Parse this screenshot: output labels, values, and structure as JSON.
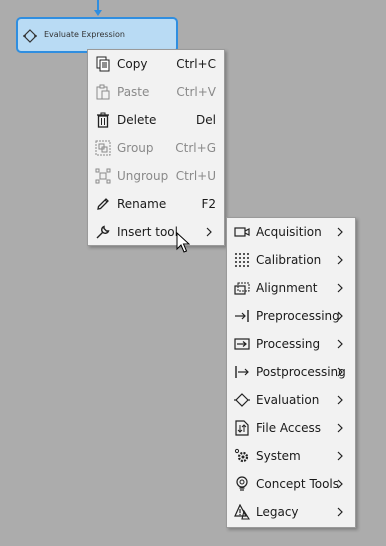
{
  "canvas": {
    "background": "#acacac",
    "accent": "#2f8ee0"
  },
  "node": {
    "label": "Evaluate Expression",
    "icon": "evaluation-icon",
    "fill": "#b9dbf4"
  },
  "context_menu": {
    "items": [
      {
        "label": "Copy",
        "shortcut": "Ctrl+C",
        "icon": "copy-icon",
        "enabled": true
      },
      {
        "label": "Paste",
        "shortcut": "Ctrl+V",
        "icon": "paste-icon",
        "enabled": false
      },
      {
        "label": "Delete",
        "shortcut": "Del",
        "icon": "trash-icon",
        "enabled": true
      },
      {
        "label": "Group",
        "shortcut": "Ctrl+G",
        "icon": "group-icon",
        "enabled": false
      },
      {
        "label": "Ungroup",
        "shortcut": "Ctrl+U",
        "icon": "ungroup-icon",
        "enabled": false
      },
      {
        "label": "Rename",
        "shortcut": "F2",
        "icon": "pencil-icon",
        "enabled": true
      },
      {
        "label": "Insert tool",
        "shortcut": "",
        "icon": "wrench-icon",
        "enabled": true,
        "submenu": true
      }
    ]
  },
  "insert_tool_menu": {
    "items": [
      {
        "label": "Acquisition",
        "icon": "camera-icon"
      },
      {
        "label": "Calibration",
        "icon": "dot-grid-icon"
      },
      {
        "label": "Alignment",
        "icon": "alignment-icon"
      },
      {
        "label": "Preprocessing",
        "icon": "preprocessing-icon"
      },
      {
        "label": "Processing",
        "icon": "processing-icon"
      },
      {
        "label": "Postprocessing",
        "icon": "postprocessing-icon"
      },
      {
        "label": "Evaluation",
        "icon": "evaluation-icon"
      },
      {
        "label": "File Access",
        "icon": "file-access-icon"
      },
      {
        "label": "System",
        "icon": "gear-icon"
      },
      {
        "label": "Concept Tools",
        "icon": "bulb-icon"
      },
      {
        "label": "Legacy",
        "icon": "legacy-warning-icon"
      }
    ]
  }
}
